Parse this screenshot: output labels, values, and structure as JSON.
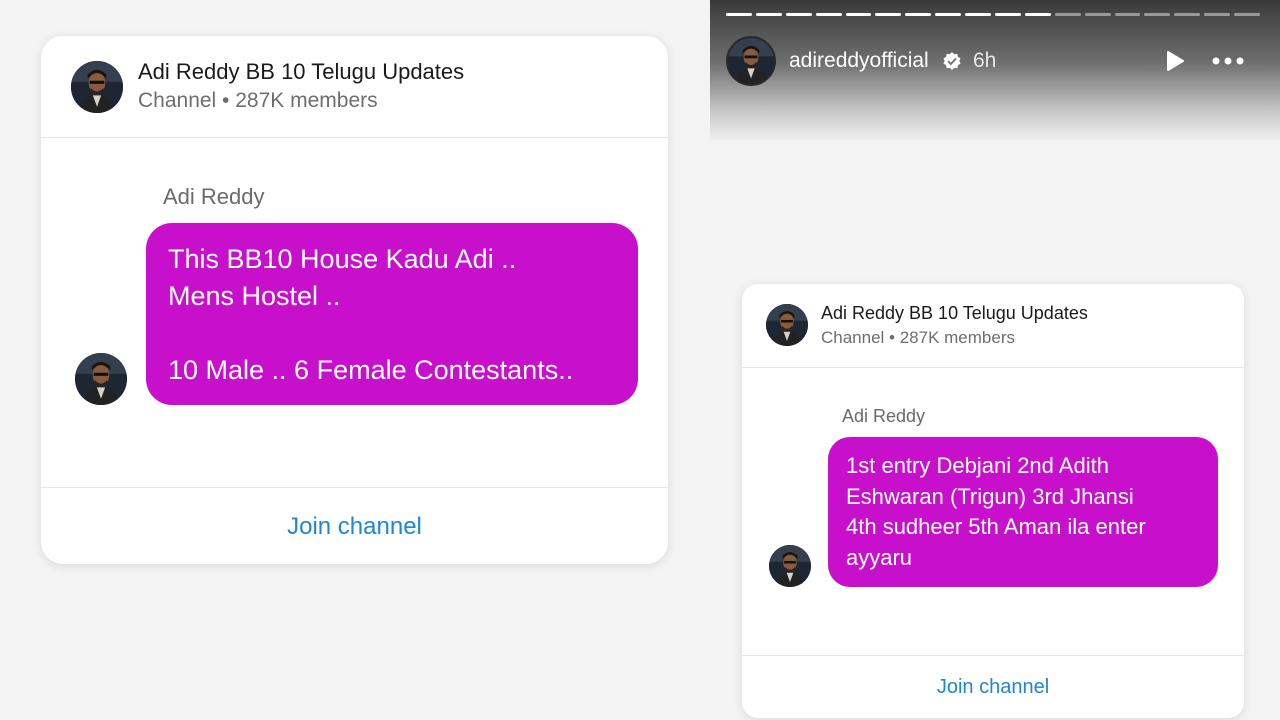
{
  "story": {
    "username": "adireddyofficial",
    "time": "6h",
    "progress": {
      "segments_total": 18,
      "segments_viewed": 11
    },
    "icons": [
      "verified-badge-icon",
      "play-icon",
      "more-options-icon"
    ]
  },
  "cards": [
    {
      "channel_name": "Adi Reddy BB 10 Telugu Updates",
      "channel_meta": "Channel • 287K members",
      "sender": "Adi Reddy",
      "message_lines": [
        "This BB10 House Kadu Adi ..",
        "Mens Hostel ..",
        "",
        "10 Male .. 6 Female Contestants.."
      ],
      "join_label": "Join channel"
    },
    {
      "channel_name": "Adi Reddy BB 10 Telugu Updates",
      "channel_meta": "Channel • 287K members",
      "sender": "Adi Reddy",
      "message_lines": [
        "1st entry Debjani 2nd Adith",
        "Eshwaran (Trigun) 3rd Jhansi",
        "4th sudheer 5th Aman ila enter",
        "ayyaru"
      ],
      "join_label": "Join channel"
    }
  ],
  "colors": {
    "bubble": "#c80fcc",
    "link": "#1e86d6",
    "background": "#f3f3f3"
  }
}
